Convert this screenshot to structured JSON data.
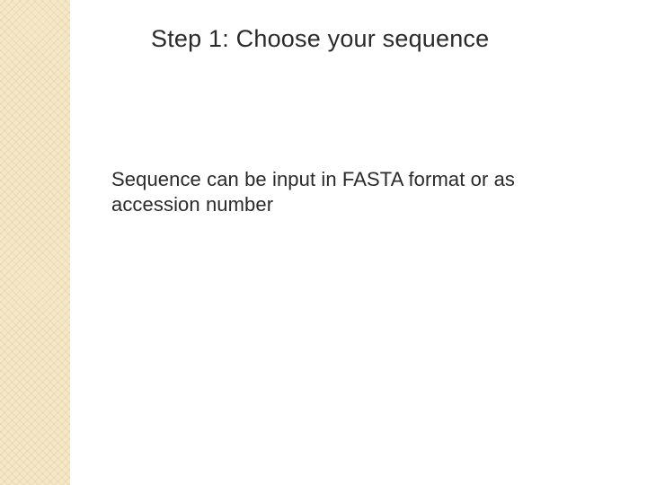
{
  "slide": {
    "title": "Step 1: Choose your sequence",
    "body": "Sequence can be input in FASTA format or as accession number"
  }
}
